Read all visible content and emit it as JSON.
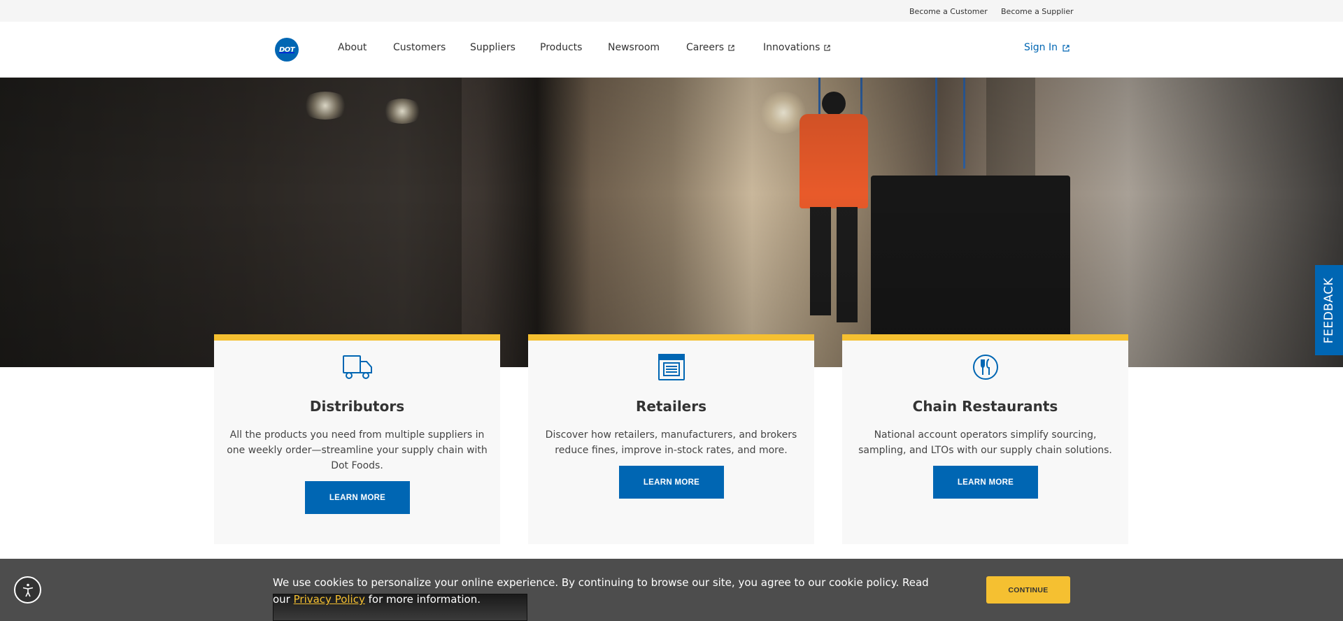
{
  "utility_bar": {
    "become_customer": "Become a Customer",
    "become_supplier": "Become a Supplier"
  },
  "header": {
    "logo_text": "DOT",
    "nav": [
      "About",
      "Customers",
      "Suppliers",
      "Products",
      "Newsroom",
      "Careers",
      "Innovations"
    ],
    "sign_in": "Sign In"
  },
  "feedback": {
    "label": "FEEDBACK"
  },
  "cards": [
    {
      "icon": "truck-icon",
      "title": "Distributors",
      "description": "All the products you need from multiple suppliers in one weekly order—streamline your supply chain with Dot Foods.",
      "button": "LEARN MORE"
    },
    {
      "icon": "storefront-icon",
      "title": "Retailers",
      "description": "Discover how retailers, manufacturers, and brokers reduce fines, improve in-stock rates, and more.",
      "button": "LEARN MORE"
    },
    {
      "icon": "utensils-icon",
      "title": "Chain Restaurants",
      "description": "National account operators simplify sourcing, sampling, and LTOs with our supply chain solutions.",
      "button": "LEARN MORE"
    }
  ],
  "cookie": {
    "text_before": "We use cookies to personalize your online experience. By continuing to browse our site, you agree to our cookie policy. Read our ",
    "link": "Privacy Policy",
    "text_after": " for more information.",
    "button": "CONTINUE"
  },
  "colors": {
    "brand_blue": "#0066b3",
    "accent_yellow": "#f5c031",
    "cookie_bg": "#4d4d4d"
  }
}
